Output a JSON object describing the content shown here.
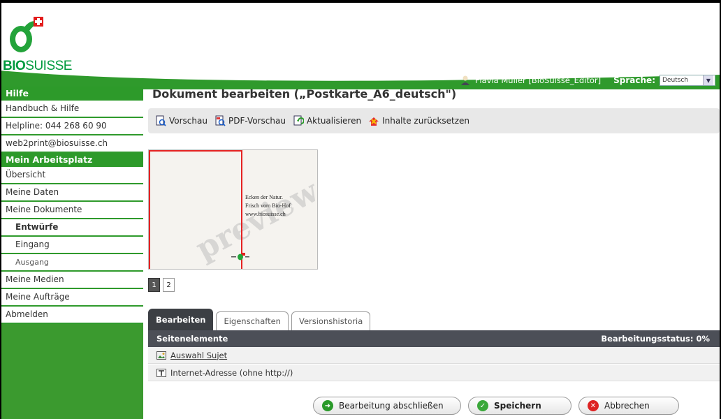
{
  "brand": {
    "logo_bold": "BIO",
    "logo_light": "SUISSE"
  },
  "header": {
    "user_name": "Flavia Müller [BioSuisse_Editor]",
    "language_label": "Sprache:",
    "language_value": "Deutsch"
  },
  "sidebar": {
    "help_heading": "Hilfe",
    "help_items": [
      "Handbuch & Hilfe",
      "Helpline: 044 268 60 90",
      "web2print@biosuisse.ch"
    ],
    "workspace_heading": "Mein Arbeitsplatz",
    "items": [
      {
        "label": "Übersicht"
      },
      {
        "label": "Meine Daten"
      },
      {
        "label": "Meine Dokumente"
      },
      {
        "label": "Entwürfe"
      },
      {
        "label": "Eingang"
      },
      {
        "label": "Ausgang"
      },
      {
        "label": "Meine Medien"
      },
      {
        "label": "Meine Aufträge"
      },
      {
        "label": "Abmelden"
      }
    ]
  },
  "main": {
    "title": "Dokument bearbeiten („Postkarte_A6_deutsch\")",
    "toolbar": {
      "preview": "Vorschau",
      "pdf_preview": "PDF-Vorschau",
      "refresh": "Aktualisieren",
      "reset": "Inhalte zurücksetzen"
    },
    "preview_card": {
      "watermark": "preview",
      "lines": [
        "Ecken der Natur.",
        "Frisch vom Bio-Hof.",
        "www.biosuisse.ch"
      ]
    },
    "pages": [
      "1",
      "2"
    ],
    "tabs": [
      "Bearbeiten",
      "Eigenschaften",
      "Versionshistoria"
    ],
    "panel": {
      "heading": "Seitenelemente",
      "status": "Bearbeitungsstatus: 0%",
      "rows": [
        "Auswahl Sujet",
        "Internet-Adresse (ohne http://)"
      ]
    },
    "actions": {
      "finish": "Bearbeitung abschließen",
      "save": "Speichern",
      "cancel": "Abbrechen"
    }
  },
  "colors": {
    "brand_green": "#2f9a2c",
    "panel_dark": "#4c4f57",
    "accent_red": "#e52222"
  }
}
